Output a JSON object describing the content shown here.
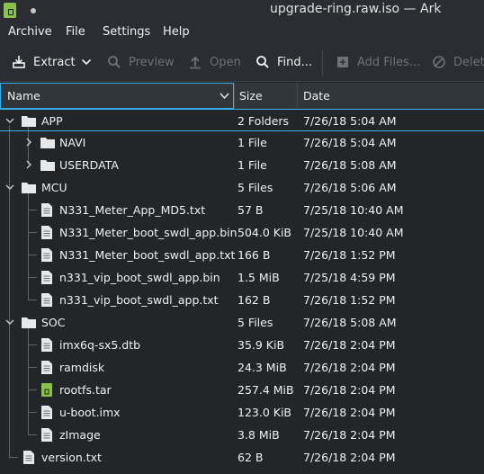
{
  "window": {
    "title": "upgrade-ring.raw.iso — Ark"
  },
  "menu": [
    "Archive",
    "File",
    "Settings",
    "Help"
  ],
  "toolbar": {
    "extract": "Extract",
    "preview": "Preview",
    "open": "Open",
    "find": "Find...",
    "add_files": "Add Files...",
    "delete": "Delete"
  },
  "columns": {
    "name": "Name",
    "size": "Size",
    "date": "Date"
  },
  "rows": [
    {
      "name": "APP",
      "size": "2 Folders",
      "date": "7/26/18 5:04 AM",
      "level": 0,
      "type": "folder",
      "expanded": true
    },
    {
      "name": "NAVI",
      "size": "1 File",
      "date": "7/26/18 5:04 AM",
      "level": 1,
      "type": "folder",
      "expanded": false
    },
    {
      "name": "USERDATA",
      "size": "1 File",
      "date": "7/26/18 5:08 AM",
      "level": 1,
      "type": "folder",
      "expanded": false
    },
    {
      "name": "MCU",
      "size": "5 Files",
      "date": "7/26/18 5:06 AM",
      "level": 0,
      "type": "folder",
      "expanded": true
    },
    {
      "name": "N331_Meter_App_MD5.txt",
      "size": "57 B",
      "date": "7/25/18 10:40 AM",
      "level": 1,
      "type": "file"
    },
    {
      "name": "N331_Meter_boot_swdl_app.bin",
      "size": "504.0 KiB",
      "date": "7/25/18 10:40 AM",
      "level": 1,
      "type": "file"
    },
    {
      "name": "N331_Meter_boot_swdl_app.txt",
      "size": "166 B",
      "date": "7/26/18 1:52 PM",
      "level": 1,
      "type": "file"
    },
    {
      "name": "n331_vip_boot_swdl_app.bin",
      "size": "1.5 MiB",
      "date": "7/25/18 4:59 PM",
      "level": 1,
      "type": "file"
    },
    {
      "name": "n331_vip_boot_swdl_app.txt",
      "size": "162 B",
      "date": "7/26/18 1:52 PM",
      "level": 1,
      "type": "file"
    },
    {
      "name": "SOC",
      "size": "5 Files",
      "date": "7/26/18 5:08 AM",
      "level": 0,
      "type": "folder",
      "expanded": true
    },
    {
      "name": "imx6q-sx5.dtb",
      "size": "35.9 KiB",
      "date": "7/26/18 2:04 PM",
      "level": 1,
      "type": "file"
    },
    {
      "name": "ramdisk",
      "size": "24.3 MiB",
      "date": "7/26/18 2:04 PM",
      "level": 1,
      "type": "file"
    },
    {
      "name": "rootfs.tar",
      "size": "257.4 MiB",
      "date": "7/26/18 2:04 PM",
      "level": 1,
      "type": "archive"
    },
    {
      "name": "u-boot.imx",
      "size": "123.0 KiB",
      "date": "7/26/18 2:04 PM",
      "level": 1,
      "type": "file"
    },
    {
      "name": "zImage",
      "size": "3.8 MiB",
      "date": "7/26/18 2:04 PM",
      "level": 1,
      "type": "file"
    },
    {
      "name": "version.txt",
      "size": "62 B",
      "date": "7/26/18 2:04 PM",
      "level": 0,
      "type": "file"
    }
  ],
  "colors": {
    "accent": "#3daee9",
    "archive": "#8bc34a",
    "background": "#232629"
  }
}
